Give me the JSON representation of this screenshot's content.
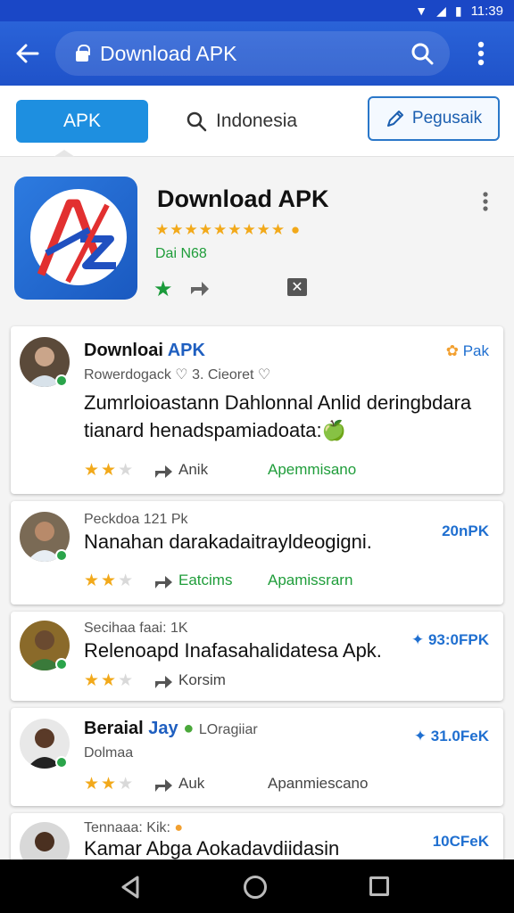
{
  "status": {
    "time": "11:39"
  },
  "toolbar": {
    "url_text": "Download APK"
  },
  "tabs": {
    "apk": "APK",
    "indonesia": "Indonesia",
    "pegusaik": "Pegusaik"
  },
  "hero": {
    "title": "Download APK",
    "stars": "★★★★★★★★★",
    "developer": "Dai N68"
  },
  "colors": {
    "primary": "#1f52c9",
    "tab_active": "#1e8fe0",
    "star": "#f2a91a",
    "green": "#1f9d3a"
  },
  "cards": [
    {
      "title_a": "Downloai",
      "title_b": "APK",
      "subtitle": "Rowerdogack ♡ 3. Cieoret ♡",
      "right": "Pak",
      "body": "Zumrloioastann Dahlonnal Anlid deringbdara tianard henadspamiadoata:🍏",
      "footer_text": "Anik",
      "footer_green": "Apemmisano"
    },
    {
      "subtitle": "Peckdoa 121 Pk",
      "right": "20nPK",
      "body": "Nanahan darakadaitrayldeogigni.",
      "footer_text": "Eatcims",
      "footer_green": "Apamissrarn"
    },
    {
      "subtitle": "Secihaa faai: 1K",
      "right": "93:0FPK",
      "body": "Relenoapd Inafasahalidatesa Apk.",
      "footer_text": "Korsim"
    },
    {
      "title_a": "Beraial",
      "title_b": "Jay",
      "subtitle_inline": "LOragiiar",
      "subtitle": "Dolmaa",
      "right": "31.0FeK",
      "footer_text": "Auk",
      "footer_grey": "Apanmiescano"
    },
    {
      "subtitle": "Tennaaa: Kik:",
      "right": "10CFeK",
      "body": "Kamar Abga Aokadavdiidasin"
    }
  ]
}
